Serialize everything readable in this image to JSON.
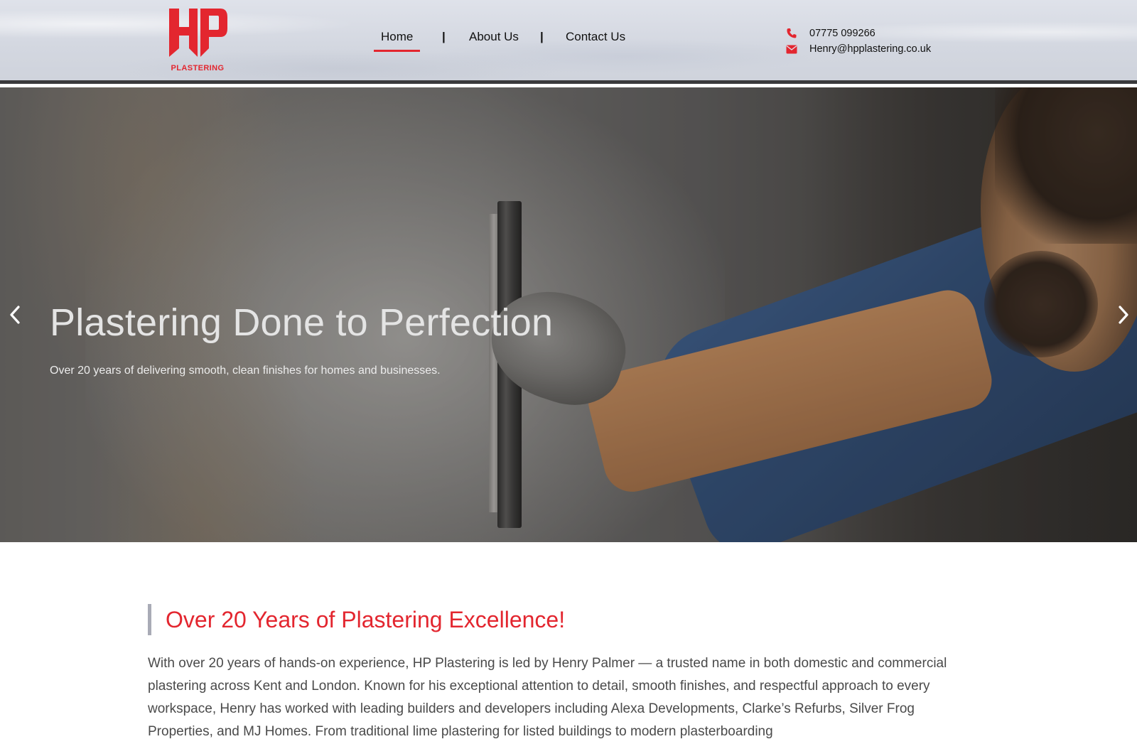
{
  "brand": {
    "logo_letters": "HP",
    "logo_word": "PLASTERING",
    "accent_color": "#e3262f"
  },
  "nav": {
    "items": [
      {
        "label": "Home",
        "active": true
      },
      {
        "label": "About Us",
        "active": false
      },
      {
        "label": "Contact Us",
        "active": false
      }
    ],
    "separator": "|"
  },
  "contact": {
    "phone_icon": "phone-icon",
    "phone": "07775 099266",
    "email_icon": "envelope-icon",
    "email": "Henry@hpplastering.co.uk"
  },
  "hero": {
    "title": "Plastering Done to Perfection",
    "subtitle": "Over 20 years of delivering smooth, clean finishes for homes and businesses.",
    "prev_icon": "chevron-left-icon",
    "next_icon": "chevron-right-icon"
  },
  "intro": {
    "heading": "Over 20 Years of Plastering Excellence!",
    "body": "With over 20 years of hands-on experience, HP Plastering is led by Henry Palmer — a trusted name in both domestic and commercial plastering across Kent and London. Known for his exceptional attention to detail, smooth finishes, and respectful approach to every workspace, Henry has worked with leading builders and developers including Alexa Developments, Clarke’s Refurbs, Silver Frog Properties, and MJ Homes. From traditional lime plastering for listed buildings to modern plasterboarding"
  }
}
